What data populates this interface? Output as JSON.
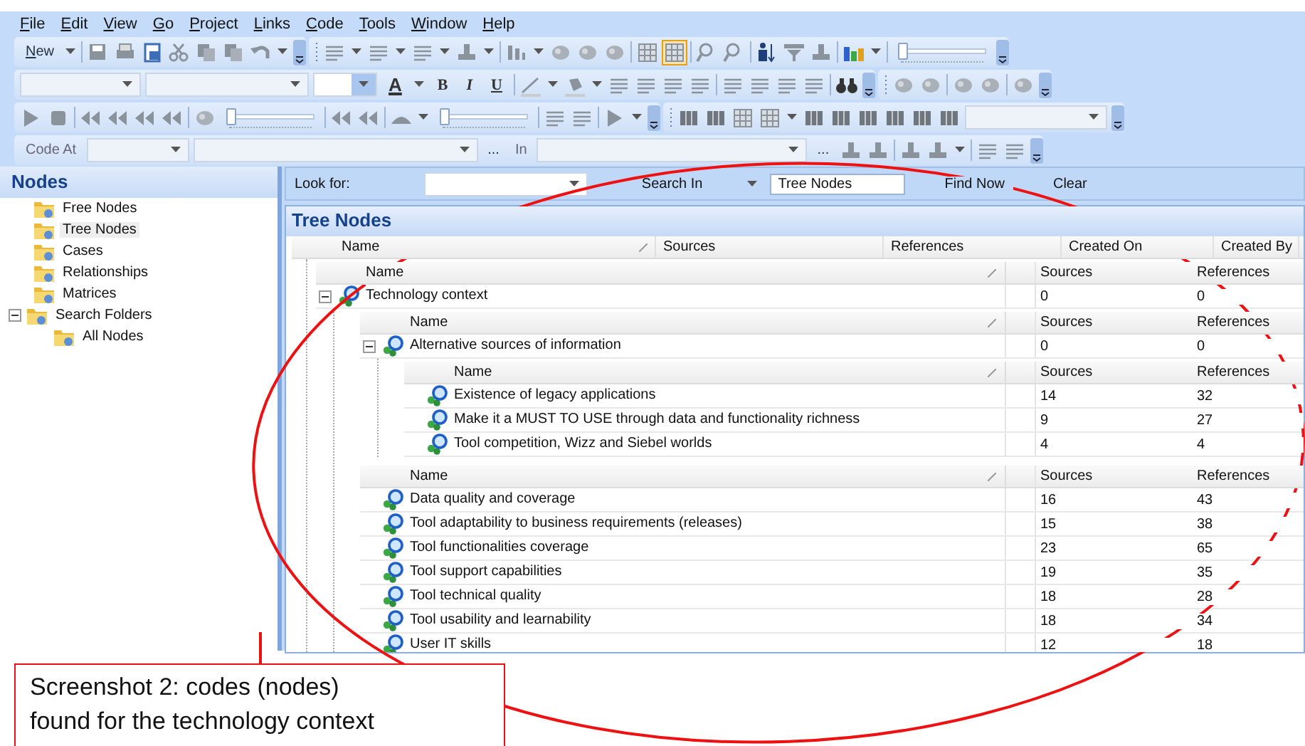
{
  "menu": [
    "File",
    "Edit",
    "View",
    "Go",
    "Project",
    "Links",
    "Code",
    "Tools",
    "Window",
    "Help"
  ],
  "toolbars": [
    {
      "labels": [
        "New"
      ],
      "view_buttons": [
        {
          "pressed": false
        },
        {
          "pressed": true
        }
      ],
      "sliders": [
        {
          "level": 0
        }
      ]
    },
    {
      "labels": [
        "A",
        "B",
        "I",
        "U"
      ]
    },
    {
      "sliders": [
        {
          "level": 0
        },
        {
          "level": 0
        }
      ]
    },
    {
      "labels": [
        "Code At",
        "...",
        "In",
        "..."
      ]
    }
  ],
  "sidebar": {
    "title": "Nodes",
    "items": [
      {
        "label": "Free Nodes",
        "selected": false
      },
      {
        "label": "Tree Nodes",
        "selected": true
      },
      {
        "label": "Cases",
        "selected": false
      },
      {
        "label": "Relationships",
        "selected": false
      },
      {
        "label": "Matrices",
        "selected": false
      },
      {
        "label": "Search Folders",
        "selected": false,
        "expanded": true,
        "children": [
          {
            "label": "All Nodes",
            "selected": false
          }
        ]
      }
    ]
  },
  "search_bar": {
    "look_for_label": "Look for:",
    "search_in_label": "Search In",
    "search_in_value": "Tree Nodes",
    "find_button": "Find Now",
    "clear_button": "Clear"
  },
  "panel": {
    "title": "Tree Nodes",
    "columns": [
      "Name",
      "Sources",
      "References",
      "Created On",
      "Created By"
    ],
    "groups": [
      {
        "columns": [
          "Name",
          "Sources",
          "References"
        ],
        "rows": [
          {
            "name": "Technology context",
            "sources": "0",
            "references": "0",
            "expanded": true,
            "groups": [
              {
                "columns": [
                  "Name",
                  "Sources",
                  "References"
                ],
                "rows": [
                  {
                    "name": "Alternative sources of information",
                    "sources": "0",
                    "references": "0",
                    "expanded": true,
                    "groups": [
                      {
                        "columns": [
                          "Name",
                          "Sources",
                          "References"
                        ],
                        "rows": [
                          {
                            "name": "Existence of legacy applications",
                            "sources": "14",
                            "references": "32"
                          },
                          {
                            "name": "Make it a MUST TO USE through data and functionality richness",
                            "sources": "9",
                            "references": "27"
                          },
                          {
                            "name": "Tool competition, Wizz and Siebel worlds",
                            "sources": "4",
                            "references": "4"
                          }
                        ]
                      }
                    ]
                  }
                ]
              },
              {
                "columns": [
                  "Name",
                  "Sources",
                  "References"
                ],
                "rows": [
                  {
                    "name": "Data quality and coverage",
                    "sources": "16",
                    "references": "43"
                  },
                  {
                    "name": "Tool adaptability to business requirements (releases)",
                    "sources": "15",
                    "references": "38"
                  },
                  {
                    "name": "Tool functionalities coverage",
                    "sources": "23",
                    "references": "65"
                  },
                  {
                    "name": "Tool support capabilities",
                    "sources": "19",
                    "references": "35"
                  },
                  {
                    "name": "Tool technical quality",
                    "sources": "18",
                    "references": "28"
                  },
                  {
                    "name": "Tool usability and learnability",
                    "sources": "18",
                    "references": "34"
                  },
                  {
                    "name": "User IT skills",
                    "sources": "12",
                    "references": "18"
                  }
                ]
              }
            ]
          }
        ]
      }
    ]
  },
  "callout": {
    "text": "Screenshot 2: codes (nodes)\nfound for the technology context"
  }
}
